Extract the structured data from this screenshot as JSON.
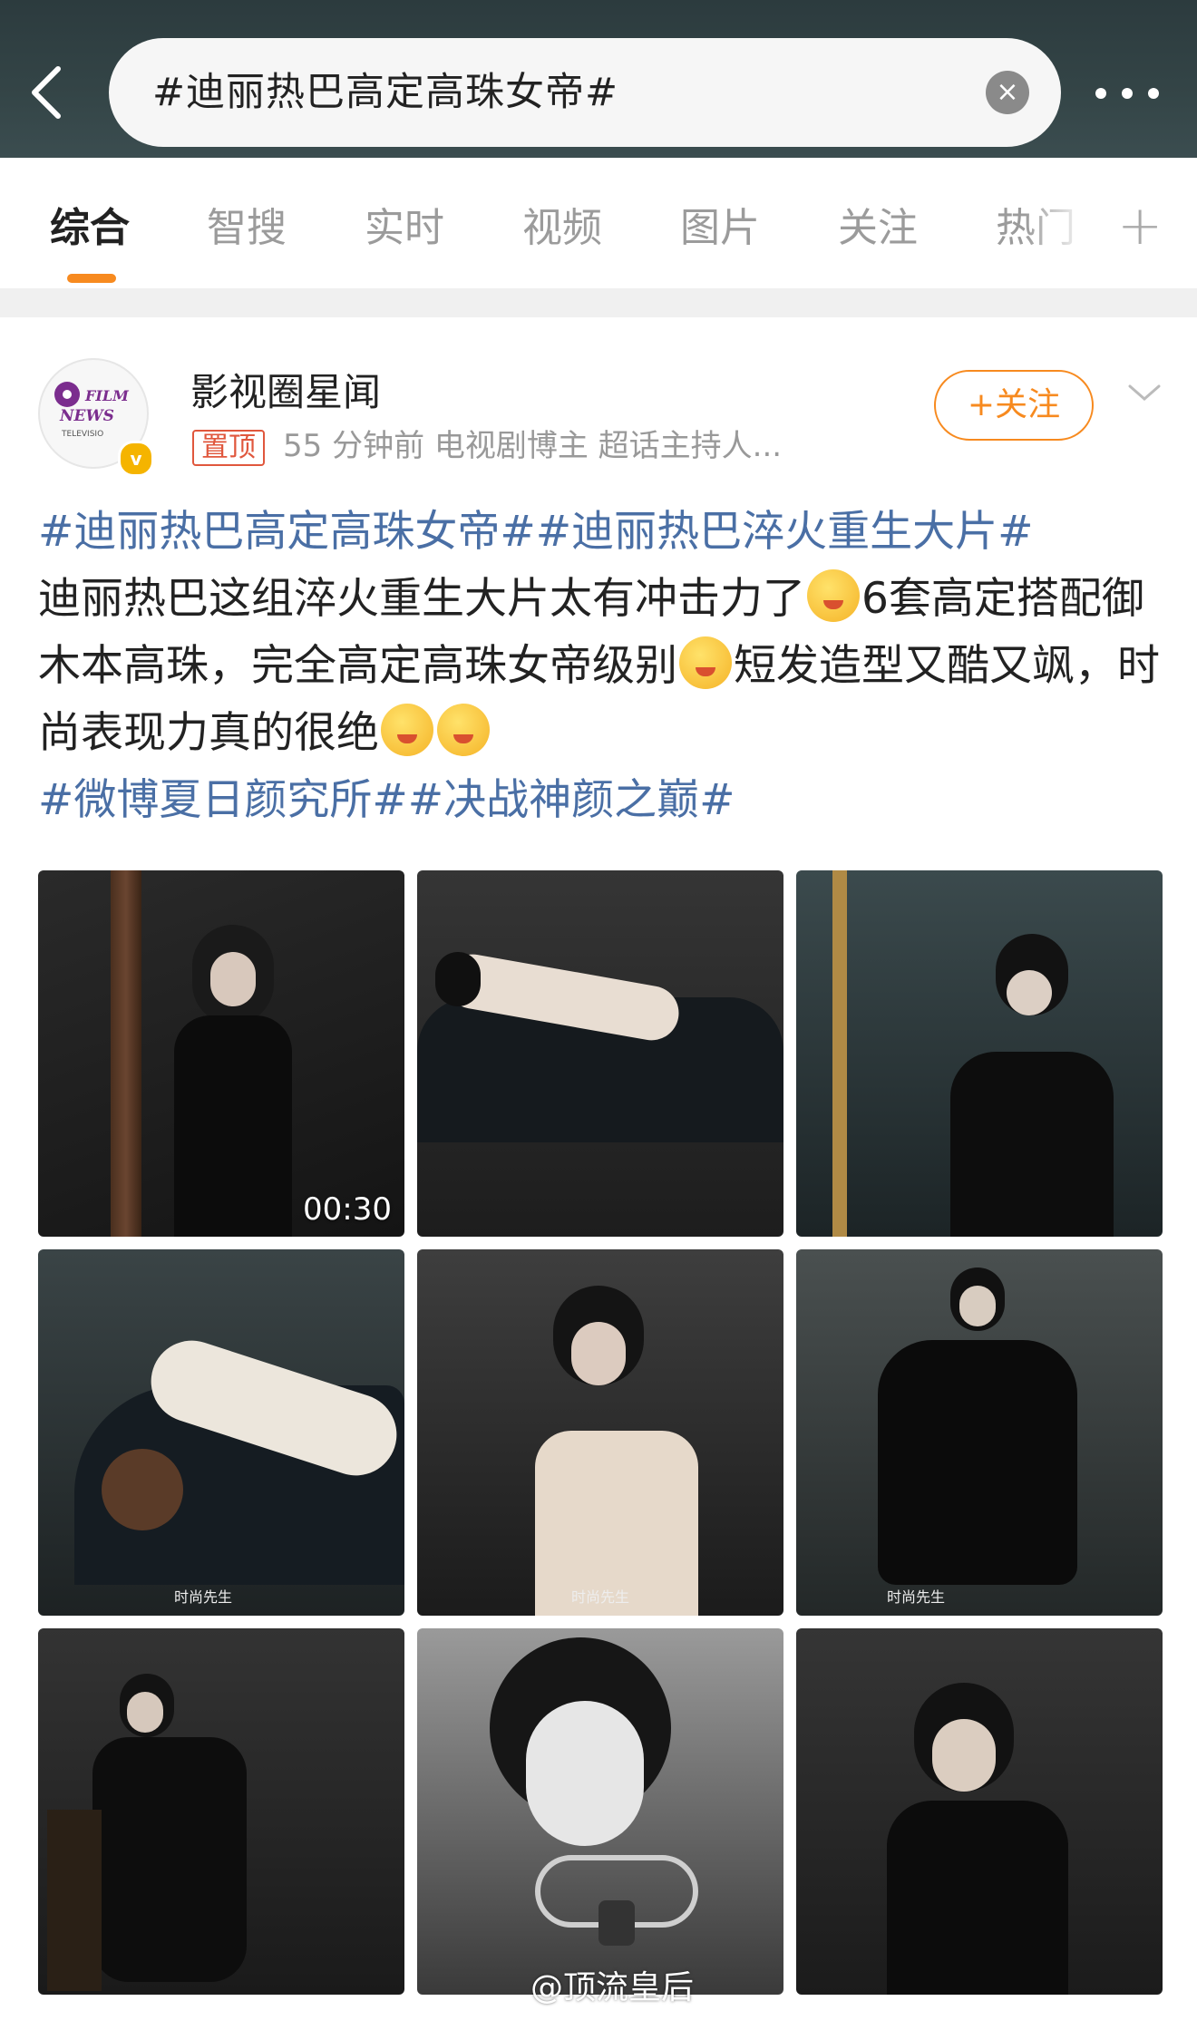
{
  "header": {
    "search_value": "#迪丽热巴高定高珠女帝#",
    "clear_icon": "×"
  },
  "tabs": [
    {
      "label": "综合",
      "active": true
    },
    {
      "label": "智搜"
    },
    {
      "label": "实时"
    },
    {
      "label": "视频"
    },
    {
      "label": "图片"
    },
    {
      "label": "关注"
    },
    {
      "label": "热门"
    }
  ],
  "tabs_add_icon": "+",
  "post": {
    "author": "影视圈星闻",
    "avatar_text": [
      "FILM",
      "NEWS",
      "TELEVISIO"
    ],
    "verified_icon": "v",
    "pinned_label": "置顶",
    "meta": "55 分钟前   电视剧博主  超话主持人...",
    "follow_label": "+关注",
    "hashtags_top": [
      "#迪丽热巴高定高珠女帝#",
      "#迪丽热巴淬火重生大片#"
    ],
    "body_line1": "迪丽热巴这组淬火重生大片太有冲击力了",
    "body_line2": "6套高定搭配御木本高珠，完全高定高珠女帝级别",
    "body_line3": "短发造型又酷又飒，时尚表现力真的很绝",
    "hashtags_bottom": [
      "#微博夏日颜究所#",
      "#决战神颜之巅#"
    ],
    "video_duration": "00:30",
    "magazine_mark": "时尚先生",
    "watermark": "@顶流皇后"
  },
  "colors": {
    "accent": "#f78a1f",
    "hashtag": "#4a6fa5",
    "header_bg": "#2c3b3e"
  }
}
